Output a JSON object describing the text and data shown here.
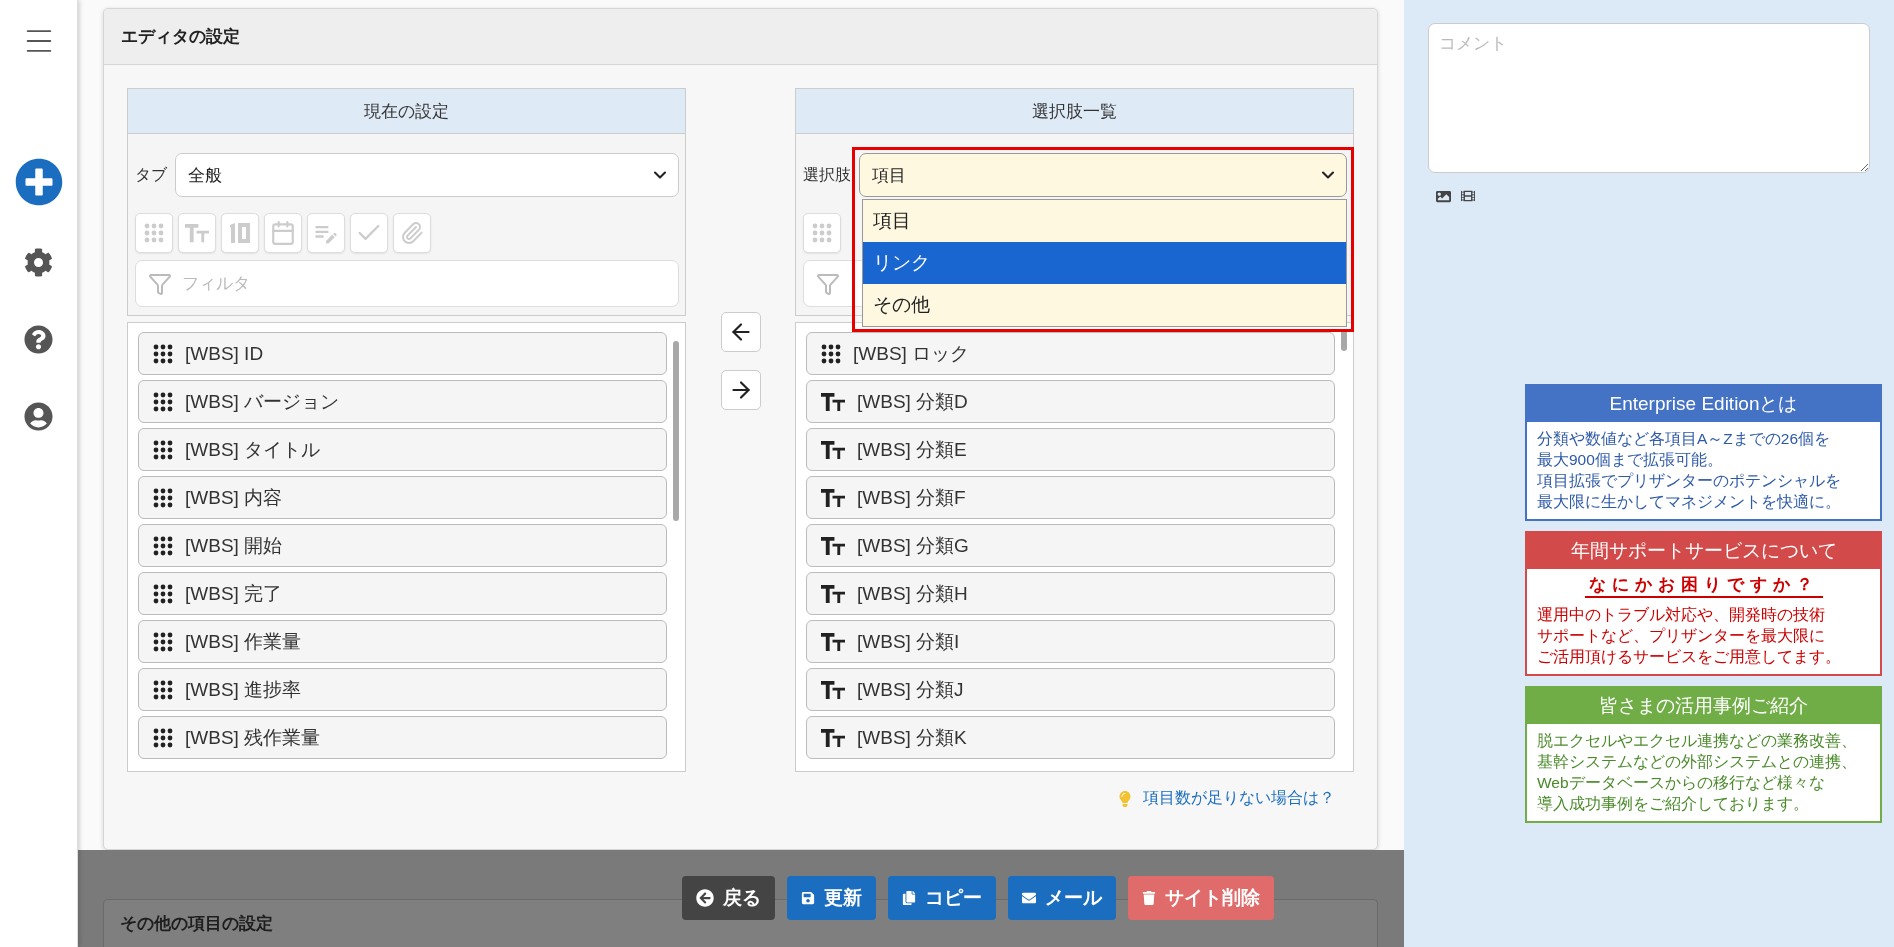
{
  "editor_card": {
    "title": "エディタの設定",
    "current_panel": {
      "header": "現在の設定",
      "tab_label": "タブ",
      "tab_value": "全般",
      "toolbar_disabled": true,
      "filter_placeholder": "フィルタ",
      "items": [
        {
          "kind": "dots",
          "label": "[WBS] ID"
        },
        {
          "kind": "dots",
          "label": "[WBS] バージョン"
        },
        {
          "kind": "dots",
          "label": "[WBS] タイトル"
        },
        {
          "kind": "dots",
          "label": "[WBS] 内容"
        },
        {
          "kind": "dots",
          "label": "[WBS] 開始"
        },
        {
          "kind": "dots",
          "label": "[WBS] 完了"
        },
        {
          "kind": "dots",
          "label": "[WBS] 作業量"
        },
        {
          "kind": "dots",
          "label": "[WBS] 進捗率"
        },
        {
          "kind": "dots",
          "label": "[WBS] 残作業量"
        }
      ]
    },
    "choices_panel": {
      "header": "選択肢一覧",
      "select_label": "選択肢",
      "select_value": "項目",
      "options": [
        {
          "label": "項目",
          "highlighted": false
        },
        {
          "label": "リンク",
          "highlighted": true
        },
        {
          "label": "その他",
          "highlighted": false
        }
      ],
      "items": [
        {
          "kind": "dots",
          "label": "[WBS] ロック"
        },
        {
          "kind": "text",
          "label": "[WBS] 分類D"
        },
        {
          "kind": "text",
          "label": "[WBS] 分類E"
        },
        {
          "kind": "text",
          "label": "[WBS] 分類F"
        },
        {
          "kind": "text",
          "label": "[WBS] 分類G"
        },
        {
          "kind": "text",
          "label": "[WBS] 分類H"
        },
        {
          "kind": "text",
          "label": "[WBS] 分類I"
        },
        {
          "kind": "text",
          "label": "[WBS] 分類J"
        },
        {
          "kind": "text",
          "label": "[WBS] 分類K"
        }
      ]
    },
    "hint_link": "項目数が足りない場合は？"
  },
  "other_card": {
    "title": "その他の項目の設定"
  },
  "actions": [
    {
      "kind": "back",
      "label": "戻る"
    },
    {
      "kind": "save",
      "label": "更新"
    },
    {
      "kind": "copy",
      "label": "コピー"
    },
    {
      "kind": "mail",
      "label": "メール"
    },
    {
      "kind": "delete",
      "label": "サイト削除"
    }
  ],
  "comment": {
    "placeholder": "コメント"
  },
  "promos": [
    {
      "kind": "plain",
      "color": "#4472c4",
      "title": "Enterprise Editionとは",
      "lines": [
        "分類や数値など各項目A～Zまでの26個を",
        "最大900個まで拡張可能。",
        "項目拡張でプリザンターのポテンシャルを",
        "最大限に生かしてマネジメントを快適に。"
      ]
    },
    {
      "kind": "support",
      "color": "#d24a4a",
      "title": "年間サポートサービスについて",
      "subtitle": "なにかお困りですか？",
      "lines": [
        "運用中のトラブル対応や、開発時の技術",
        "サポートなど、プリザンターを最大限に",
        "ご活用頂けるサービスをご用意してます。"
      ]
    },
    {
      "kind": "plain",
      "color": "#70ad47",
      "title": "皆さまの活用事例ご紹介",
      "lines": [
        "脱エクセルやエクセル連携などの業務改善、",
        "基幹システムなどの外部システムとの連携、",
        "Webデータベースからの移行など様々な",
        "導入成功事例をご紹介しております。"
      ]
    }
  ]
}
